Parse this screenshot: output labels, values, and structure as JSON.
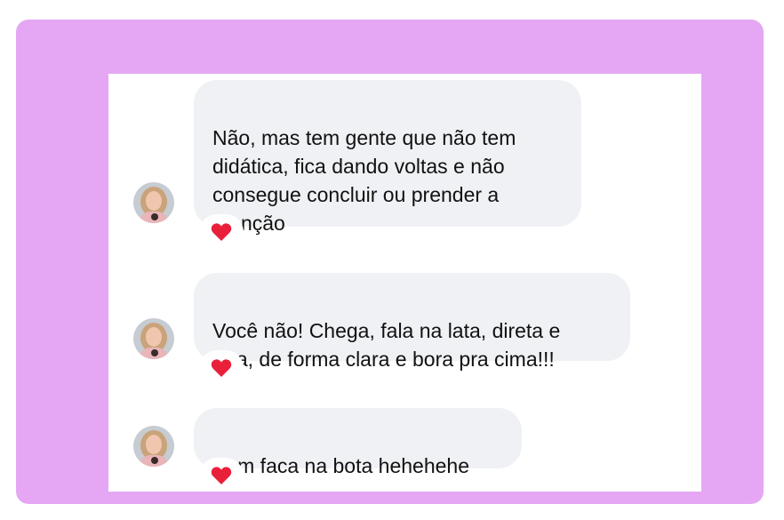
{
  "messages": [
    {
      "text": "Não, mas tem gente que não tem\ndidática, fica dando voltas e não\nconsegue concluir ou prender a\natenção",
      "reaction": "heart-icon"
    },
    {
      "text": "Você não! Chega, fala na lata, direta e\nreta, de forma clara e bora pra cima!!!",
      "reaction": "heart-icon"
    },
    {
      "text": "Bem faca na bota hehehehe",
      "reaction": "heart-icon"
    }
  ],
  "colors": {
    "frame": "#e5a7f4",
    "bubble": "#f0f1f4",
    "heart": "#e8203a"
  }
}
